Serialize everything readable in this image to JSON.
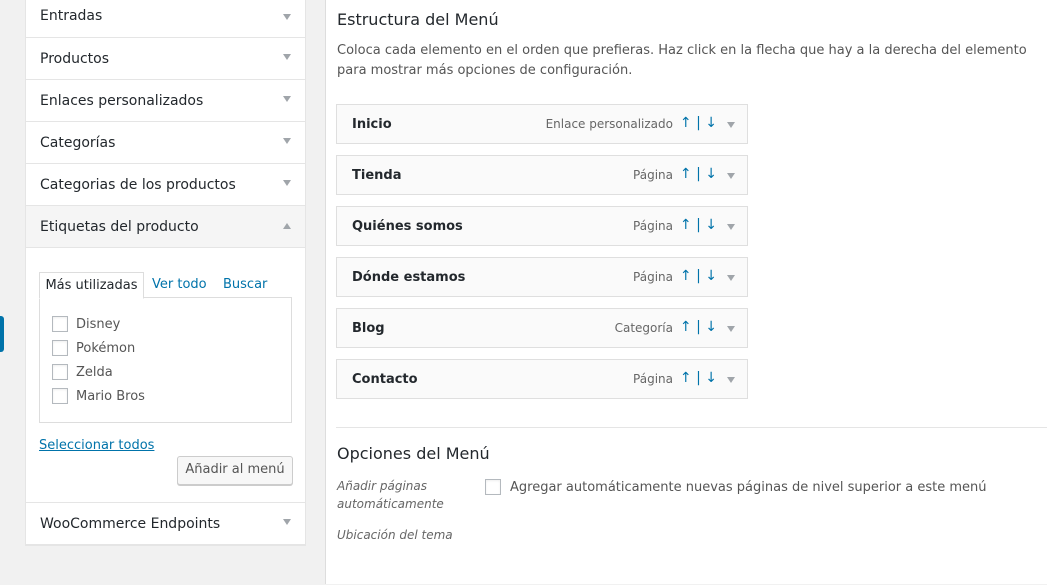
{
  "accordion": {
    "sections": [
      {
        "label": "Entradas"
      },
      {
        "label": "Productos"
      },
      {
        "label": "Enlaces personalizados"
      },
      {
        "label": "Categorías"
      },
      {
        "label": "Categorias de los productos"
      },
      {
        "label": "Etiquetas del producto"
      },
      {
        "label": "WooCommerce Endpoints"
      }
    ],
    "tags_panel": {
      "tabs": [
        "Más utilizadas",
        "Ver todo",
        "Buscar"
      ],
      "items": [
        "Disney",
        "Pokémon",
        "Zelda",
        "Mario Bros"
      ],
      "select_all": "Seleccionar todos",
      "add_button": "Añadir al menú"
    }
  },
  "structure": {
    "title": "Estructura del Menú",
    "description": "Coloca cada elemento en el orden que prefieras. Haz click en la flecha que hay a la derecha del elemento para mostrar más opciones de configuración.",
    "order_label": "↑ | ↓",
    "items": [
      {
        "title": "Inicio",
        "type": "Enlace personalizado"
      },
      {
        "title": "Tienda",
        "type": "Página"
      },
      {
        "title": "Quiénes somos",
        "type": "Página"
      },
      {
        "title": "Dónde estamos",
        "type": "Página"
      },
      {
        "title": "Blog",
        "type": "Categoría"
      },
      {
        "title": "Contacto",
        "type": "Página"
      }
    ]
  },
  "options": {
    "title": "Opciones del Menú",
    "auto_add_label": "Añadir páginas automáticamente",
    "auto_add_checkbox": "Agregar automáticamente nuevas páginas de nivel superior a este menú",
    "location_label": "Ubicación del tema"
  }
}
